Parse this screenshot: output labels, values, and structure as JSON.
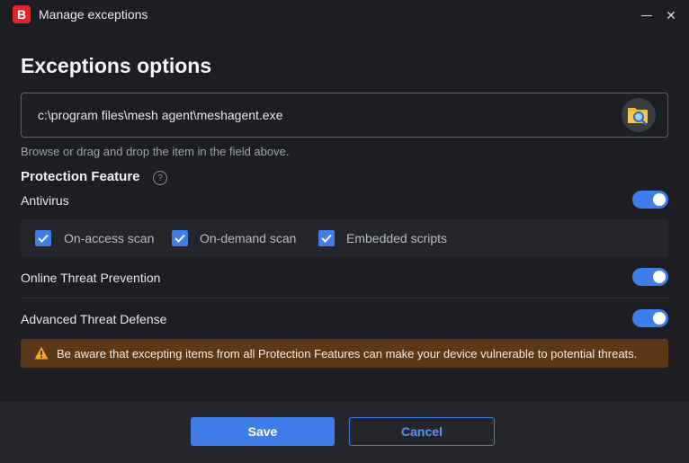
{
  "window": {
    "logo_letter": "B",
    "title": "Manage exceptions",
    "minimize_icon": "minimize-icon",
    "close_glyph": "✕"
  },
  "page": {
    "title": "Exceptions options"
  },
  "path_field": {
    "value": "c:\\program files\\mesh agent\\meshagent.exe",
    "browse_icon": "folder-search-icon",
    "hint": "Browse or drag and drop the item in the field above."
  },
  "protection": {
    "title": "Protection Feature",
    "help_glyph": "?",
    "antivirus": {
      "label": "Antivirus",
      "enabled": true,
      "options": [
        {
          "label": "On-access scan",
          "checked": true
        },
        {
          "label": "On-demand scan",
          "checked": true
        },
        {
          "label": "Embedded scripts",
          "checked": true
        }
      ]
    },
    "online_threat": {
      "label": "Online Threat Prevention",
      "enabled": true
    },
    "advanced_threat": {
      "label": "Advanced Threat Defense",
      "enabled": true
    }
  },
  "warning": {
    "icon": "warning-icon",
    "text": "Be aware that excepting items from all Protection Features can make your device vulnerable to potential threats."
  },
  "footer": {
    "save_label": "Save",
    "cancel_label": "Cancel"
  },
  "colors": {
    "accent": "#3f7ee8",
    "brand": "#e3262b",
    "warning_bg": "#5a3818",
    "warning_icon": "#f2a533"
  }
}
